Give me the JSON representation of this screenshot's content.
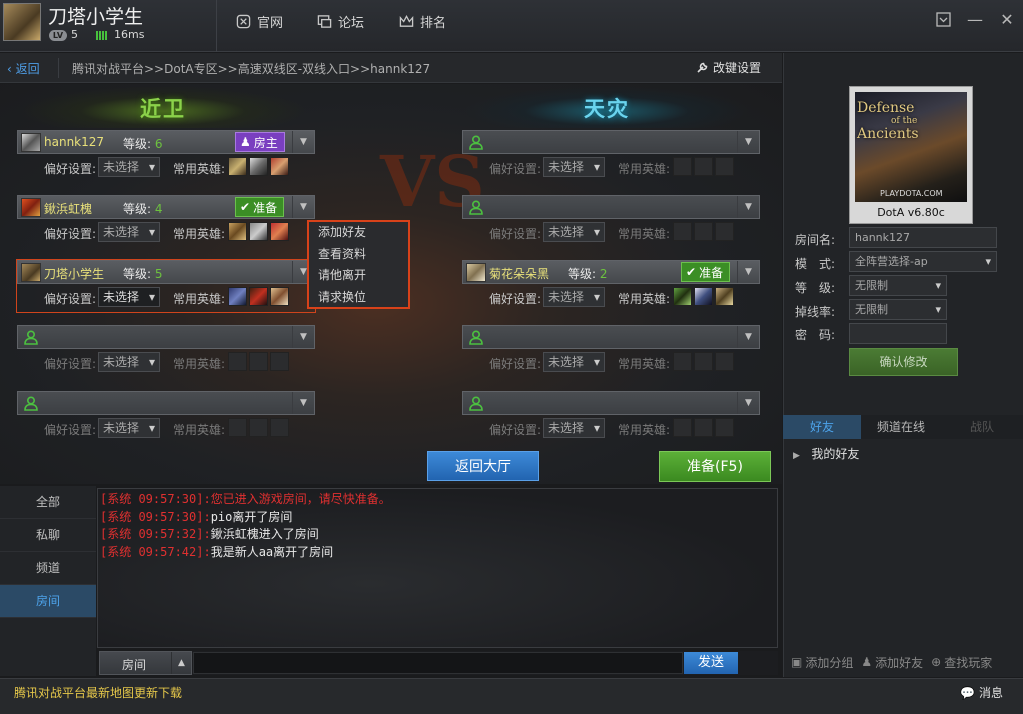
{
  "user": {
    "name": "刀塔小学生",
    "lv_label": "LV",
    "level": "5",
    "ping": "16ms"
  },
  "nav": {
    "official": "官网",
    "forum": "论坛",
    "ranking": "排名"
  },
  "breadcrumb": {
    "back": "返回",
    "path": "腾讯对战平台>>DotA专区>>高速双线区-双线入口>>hannk127",
    "modify": "改键设置"
  },
  "teams": {
    "left": "近卫",
    "right": "天灾"
  },
  "labels": {
    "level": "等级:",
    "pref": "偏好设置:",
    "heroes": "常用英雄:",
    "unselected": "未选择"
  },
  "left_slots": [
    {
      "name": "hannk127",
      "level": "6",
      "tag": "房主"
    },
    {
      "name": "鍬浜虹槐",
      "level": "4",
      "tag": "准备"
    },
    {
      "name": "刀塔小学生",
      "level": "5"
    }
  ],
  "right_slots": [
    {
      "name": "菊花朵朵黑",
      "level": "2",
      "tag": "准备"
    }
  ],
  "context_menu": [
    "添加好友",
    "查看资料",
    "请他离开",
    "请求换位"
  ],
  "buttons": {
    "lobby": "返回大厅",
    "ready": "准备(F5)",
    "send": "发送"
  },
  "chat_tabs": [
    "全部",
    "私聊",
    "频道",
    "房间"
  ],
  "chat_messages": [
    {
      "sys": "[系统 09:57:30]:",
      "text": "您已进入游戏房间，请尽快准备。"
    },
    {
      "sys": "[系统 09:57:30]:",
      "text": "pio离开了房间"
    },
    {
      "sys": "[系统 09:57:32]:",
      "text": "鍬浜虹槐进入了房间"
    },
    {
      "sys": "[系统 09:57:42]:",
      "text": "我是新人aa离开了房间"
    }
  ],
  "chat_channel": "房间",
  "map": {
    "title_line1": "Defense",
    "title_line2": "of the",
    "title_line3": "Ancients",
    "site": "PLAYDOTA.COM",
    "name": "DotA v6.80c"
  },
  "room": {
    "name_label": "房间名:",
    "name": "hannk127",
    "mode_label": "模　式:",
    "mode": "全阵营选择-ap",
    "level_label": "等　级:",
    "level": "无限制",
    "drop_label": "掉线率:",
    "drop": "无限制",
    "pwd_label": "密　码:",
    "confirm": "确认修改"
  },
  "right_tabs": [
    "好友",
    "频道在线",
    "战队"
  ],
  "friends": {
    "group": "我的好友"
  },
  "right_bottom": {
    "add_group": "添加分组",
    "add_friend": "添加好友",
    "find_player": "查找玩家"
  },
  "bottom": {
    "news": "腾讯对战平台最新地图更新下载",
    "messages": "消息"
  },
  "colors": {
    "accent_blue": "#4f9fe8",
    "ready_green": "#3b8e25",
    "host_purple": "#7a3fc0",
    "system_red": "#e03030",
    "menu_border": "#d8421a"
  }
}
